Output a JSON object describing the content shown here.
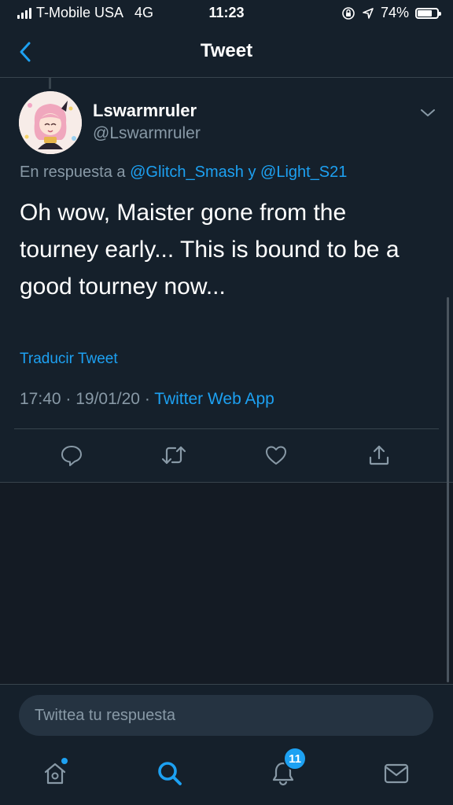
{
  "status_bar": {
    "carrier": "T-Mobile USA",
    "network": "4G",
    "time": "11:23",
    "battery_percent": "74%",
    "battery_level": 0.74
  },
  "nav": {
    "title": "Tweet",
    "back_icon": "chevron-left-icon"
  },
  "tweet": {
    "display_name": "Lswarmruler",
    "username": "@Lswarmruler",
    "reply_prefix": "En respuesta a ",
    "mention_1": "@Glitch_Smash",
    "reply_joiner": " y ",
    "mention_2": "@Light_S21",
    "text": "Oh wow, Maister gone from the tourney early... This is bound to be a good tourney now...",
    "translate": "Traducir Tweet",
    "time": "17:40",
    "date": "19/01/20",
    "separator": " · ",
    "source": "Twitter Web App"
  },
  "actions": [
    "reply-icon",
    "retweet-icon",
    "like-icon",
    "share-icon"
  ],
  "reply": {
    "placeholder": "Twittea tu respuesta"
  },
  "tab_bar": {
    "notifications_badge": "11",
    "tabs": [
      "home-icon",
      "search-icon",
      "notifications-icon",
      "messages-icon"
    ]
  },
  "colors": {
    "background": "#15202b",
    "accent": "#1da1f2",
    "secondary_text": "#8899a6",
    "divider": "#38444d"
  }
}
